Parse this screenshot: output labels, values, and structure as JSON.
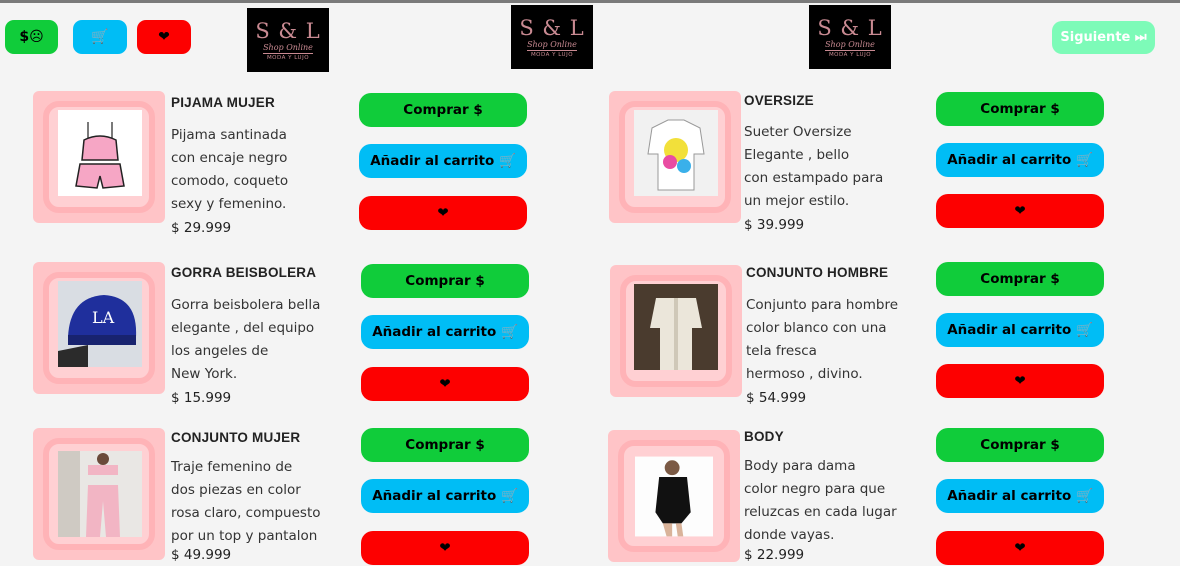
{
  "header": {
    "dollar_btn": "$☹",
    "cart_btn": "🛒",
    "heart_btn": "❤",
    "logo": {
      "line1": "S & L",
      "line2": "Shop Online",
      "line3": "MODA Y LUJO"
    },
    "next_btn": "Siguiente ⏭"
  },
  "buttons": {
    "buy": "Comprar  $",
    "add_cart": "Añadir al carrito 🛒",
    "fav": "❤"
  },
  "products": [
    {
      "title": "PIJAMA MUJER",
      "desc": [
        "Pijama santinada",
        "con encaje negro",
        "comodo, coqueto",
        "sexy y femenino."
      ],
      "price": "$ 29.999",
      "icon": "pink-lace-pajama-photo"
    },
    {
      "title": "OVERSIZE",
      "desc": [
        "Sueter Oversize",
        "Elegante , bello",
        "con estampado para",
        "un mejor estilo."
      ],
      "price": "$ 39.999",
      "icon": "oversize-tee-photo"
    },
    {
      "title": "GORRA BEISBOLERA",
      "desc": [
        "Gorra beisbolera bella",
        "elegante , del equipo",
        "los angeles de",
        "New York."
      ],
      "price": "$ 15.999",
      "icon": "blue-baseball-cap-photo"
    },
    {
      "title": "CONJUNTO HOMBRE",
      "desc": [
        "Conjunto para hombre",
        "color blanco con una",
        "tela fresca",
        "hermoso , divino."
      ],
      "price": "$ 54.999",
      "icon": "white-men-set-photo"
    },
    {
      "title": "CONJUNTO MUJER",
      "desc": [
        "Traje femenino de",
        "dos piezas en color",
        "rosa claro, compuesto",
        "por un top y pantalon"
      ],
      "price": "$ 49.999",
      "icon": "pink-women-set-photo"
    },
    {
      "title": "BODY",
      "desc": [
        "Body para dama",
        "color negro para que",
        "reluzcas en cada lugar",
        "donde vayas."
      ],
      "price": "$ 22.999",
      "icon": "black-bodysuit-photo"
    }
  ],
  "colors": {
    "green": "#10cc3a",
    "blue": "#00bdf5",
    "red": "#fd0000",
    "next": "#7dfbb8",
    "frame": "#ffc4c7"
  }
}
